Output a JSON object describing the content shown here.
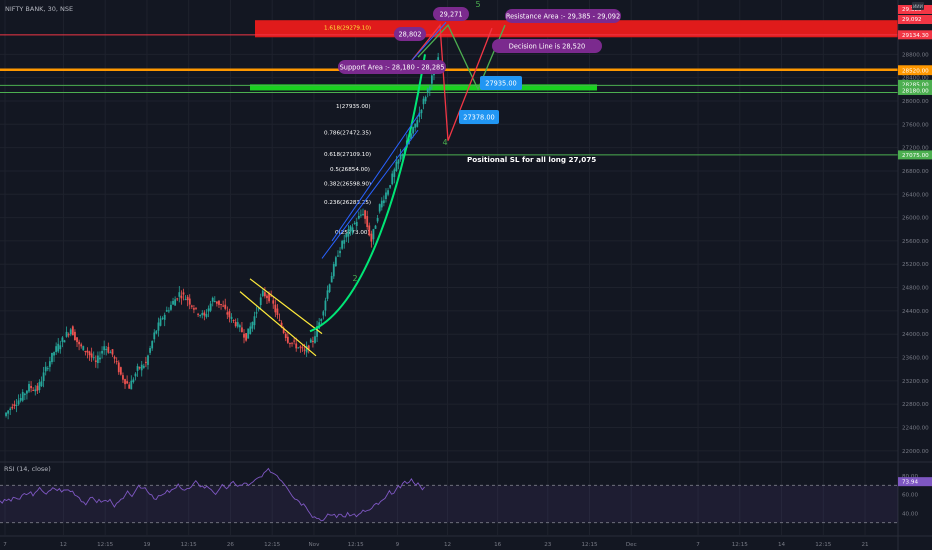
{
  "header": {
    "symbol_title": "NIFTY BANK, 30, NSE",
    "top_badge": "ИИИ"
  },
  "chart_data": {
    "type": "candlestick",
    "title": "NIFTY BANK, 30, NSE",
    "ylim": [
      21980,
      29560
    ],
    "y_ticks": [
      22000,
      22400,
      22800,
      23200,
      23600,
      24000,
      24400,
      24800,
      25200,
      25600,
      26000,
      26400,
      26800,
      27200,
      27600,
      28000,
      28400,
      28800
    ],
    "x_ticks": [
      {
        "label": "7",
        "idx": 0
      },
      {
        "label": "12",
        "idx": 7
      },
      {
        "label": "12:15",
        "idx": 12
      },
      {
        "label": "19",
        "idx": 17
      },
      {
        "label": "12:15",
        "idx": 22
      },
      {
        "label": "26",
        "idx": 27
      },
      {
        "label": "12:15",
        "idx": 32
      },
      {
        "label": "Nov",
        "idx": 37
      },
      {
        "label": "12:15",
        "idx": 42
      },
      {
        "label": "9",
        "idx": 47
      },
      {
        "label": "12",
        "idx": 53
      },
      {
        "label": "16",
        "idx": 59
      },
      {
        "label": "23",
        "idx": 65
      },
      {
        "label": "12:15",
        "idx": 70
      },
      {
        "label": "Dec",
        "idx": 75
      },
      {
        "label": "7",
        "idx": 83
      },
      {
        "label": "12:15",
        "idx": 88
      },
      {
        "label": "14",
        "idx": 93
      },
      {
        "label": "12:15",
        "idx": 98
      },
      {
        "label": "21",
        "idx": 103
      }
    ],
    "price_path": [
      [
        0,
        22600
      ],
      [
        1,
        22780
      ],
      [
        2,
        22900
      ],
      [
        3,
        23100
      ],
      [
        4,
        23050
      ],
      [
        5,
        23400
      ],
      [
        6,
        23700
      ],
      [
        7,
        23900
      ],
      [
        8,
        24100
      ],
      [
        9,
        23800
      ],
      [
        10,
        23700
      ],
      [
        11,
        23500
      ],
      [
        12,
        23800
      ],
      [
        13,
        23650
      ],
      [
        14,
        23300
      ],
      [
        15,
        23100
      ],
      [
        16,
        23400
      ],
      [
        17,
        23500
      ],
      [
        18,
        24000
      ],
      [
        19,
        24300
      ],
      [
        20,
        24500
      ],
      [
        21,
        24700
      ],
      [
        22,
        24600
      ],
      [
        23,
        24400
      ],
      [
        24,
        24300
      ],
      [
        25,
        24600
      ],
      [
        26,
        24500
      ],
      [
        27,
        24300
      ],
      [
        28,
        24150
      ],
      [
        29,
        23950
      ],
      [
        30,
        24300
      ],
      [
        31,
        24700
      ],
      [
        32,
        24600
      ],
      [
        33,
        24200
      ],
      [
        34,
        23900
      ],
      [
        35,
        23800
      ],
      [
        36,
        23700
      ],
      [
        37,
        23900
      ],
      [
        38,
        24300
      ],
      [
        39,
        24900
      ],
      [
        40,
        25400
      ],
      [
        41,
        25700
      ],
      [
        42,
        25900
      ],
      [
        43,
        26100
      ],
      [
        44,
        25600
      ],
      [
        45,
        26200
      ],
      [
        46,
        26500
      ],
      [
        47,
        26900
      ],
      [
        48,
        27200
      ],
      [
        49,
        27500
      ],
      [
        50,
        27900
      ],
      [
        51,
        28300
      ],
      [
        52,
        28700
      ]
    ],
    "fibonacci": [
      {
        "label": "1.618(29279.10)",
        "price": 29279.1
      },
      {
        "label": "1(27935.00)",
        "price": 27935.0
      },
      {
        "label": "0.786(27472.35)",
        "price": 27472.35
      },
      {
        "label": "0.618(27109.10)",
        "price": 27109.1
      },
      {
        "label": "0.5(26854.00)",
        "price": 26854.0
      },
      {
        "label": "0.382(26598.90)",
        "price": 26598.9
      },
      {
        "label": "0.236(26283.25)",
        "price": 26283.25
      },
      {
        "label": "0(25773.00)",
        "price": 25773.0
      }
    ],
    "horizontal_levels": [
      {
        "price": 29134.3,
        "label": "29134.30",
        "color": "#f23645"
      },
      {
        "price": 28535.0,
        "label": "28535.00",
        "color": "#ff9800"
      },
      {
        "price": 28520.0,
        "label": "28520.00",
        "color": "#ff9800"
      },
      {
        "price": 28285.0,
        "label": "28285.00",
        "color": "#4caf50"
      },
      {
        "price": 28180.0,
        "label": "28180.00",
        "color": "#4caf50"
      },
      {
        "price": 27075.0,
        "label": "27075.00",
        "color": "#4caf50"
      }
    ],
    "zones": [
      {
        "name": "resistance",
        "from": 29092,
        "to": 29385,
        "color": "#e01b1b"
      },
      {
        "name": "support",
        "from": 28180,
        "to": 28285,
        "color": "#19d11f"
      }
    ],
    "annotations": [
      {
        "text": "Resistance Area :- 29,385 - 29,092",
        "style": "purple"
      },
      {
        "text": "Decision Line is 28,520",
        "style": "purple"
      },
      {
        "text": "Support Area :- 28,180 - 28,285",
        "style": "purple"
      },
      {
        "text": "Positional SL for all long 27,075",
        "style": "plain"
      },
      {
        "text": "29,271",
        "style": "purple"
      },
      {
        "text": "28,802",
        "style": "purple"
      },
      {
        "text": "27935.00",
        "style": "blue"
      },
      {
        "text": "27378.00",
        "style": "blue"
      }
    ],
    "wave_labels": [
      "5",
      "4",
      "2"
    ],
    "last_price_tags": [
      "28535.00",
      "28520.00"
    ],
    "top_tags": [
      "29,385",
      "29,092"
    ],
    "rsi": {
      "title": "RSI (14, close)",
      "value": 73.94,
      "value_label": "73.94",
      "ylim": [
        20,
        95
      ],
      "ticks": [
        80.0,
        60.0,
        40.0
      ],
      "tick_labels": [
        "80.00",
        "60.00",
        "40.00"
      ],
      "bands": [
        70,
        30
      ]
    },
    "colors": {
      "up": "#26a69a",
      "down": "#ef5350",
      "bg": "#131722",
      "grid": "#1e222d",
      "rsi_line": "#7e57c2"
    }
  }
}
